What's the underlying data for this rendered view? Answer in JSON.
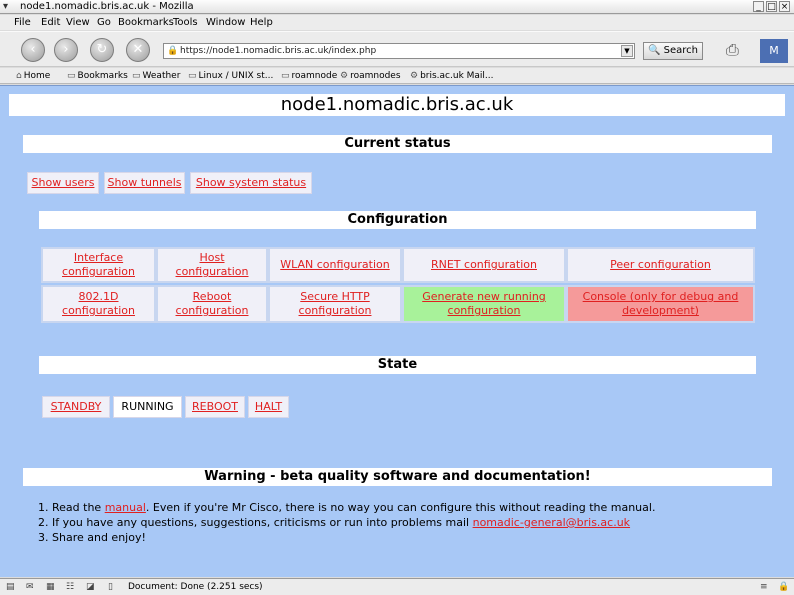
{
  "window": {
    "title": "node1.nomadic.bris.ac.uk - Mozilla",
    "menu_icon": "chevron-down-icon",
    "controls": [
      "_",
      "□",
      "×"
    ]
  },
  "menu": [
    "File",
    "Edit",
    "View",
    "Go",
    "Bookmarks",
    "Tools",
    "Window",
    "Help"
  ],
  "nav": {
    "back_icon": "‹",
    "forward_icon": "›",
    "reload_icon": "↻",
    "stop_icon": "✕",
    "url": "https://node1.nomadic.bris.ac.uk/index.php",
    "search_label": "Search"
  },
  "bookmarks": [
    "Home",
    "Bookmarks",
    "Weather",
    "Linux / UNIX st...",
    "roamnode",
    "roamnodes",
    "bris.ac.uk Mail..."
  ],
  "page": {
    "title": "node1.nomadic.bris.ac.uk",
    "current_status": {
      "heading": "Current status",
      "buttons": [
        "Show users",
        "Show tunnels",
        "Show system status"
      ]
    },
    "configuration": {
      "heading": "Configuration",
      "row1": [
        "Interface configuration",
        "Host configuration",
        "WLAN configuration",
        "RNET configuration",
        "Peer configuration"
      ],
      "row2": [
        "802.1D configuration",
        "Reboot configuration",
        "Secure HTTP configuration",
        "Generate new running configuration",
        "Console (only for debug and development)"
      ]
    },
    "state": {
      "heading": "State",
      "buttons": [
        "STANDBY",
        "RUNNING",
        "REBOOT",
        "HALT"
      ],
      "current": "RUNNING"
    },
    "warning": {
      "heading": "Warning - beta quality software and documentation!",
      "items": [
        {
          "num": "1.",
          "pre": "Read the ",
          "link": "manual",
          "post": ". Even if you're Mr Cisco, there is no way you can configure this without reading the manual."
        },
        {
          "num": "2.",
          "pre": "If you have any questions, suggestions, criticisms or run into problems mail ",
          "link": "nomadic-general@bris.ac.uk",
          "post": ""
        },
        {
          "num": "3.",
          "pre": "Share and enjoy!",
          "link": "",
          "post": ""
        }
      ]
    }
  },
  "status": {
    "text": "Document: Done (2.251 secs)"
  },
  "colors": {
    "page_bg": "#a8c8f6",
    "link": "#e02020",
    "generate_bg": "#a8f29a",
    "console_bg": "#f59a9a"
  }
}
